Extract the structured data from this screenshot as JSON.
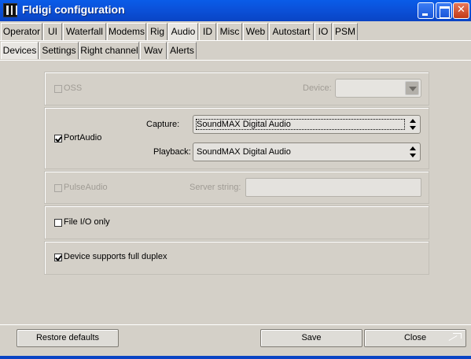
{
  "window": {
    "title": "Fldigi configuration"
  },
  "main_tabs": [
    {
      "label": "Operator",
      "active": false
    },
    {
      "label": "UI",
      "active": false
    },
    {
      "label": "Waterfall",
      "active": false
    },
    {
      "label": "Modems",
      "active": false
    },
    {
      "label": "Rig",
      "active": false
    },
    {
      "label": "Audio",
      "active": true
    },
    {
      "label": "ID",
      "active": false
    },
    {
      "label": "Misc",
      "active": false
    },
    {
      "label": "Web",
      "active": false
    },
    {
      "label": "Autostart",
      "active": false
    },
    {
      "label": "IO",
      "active": false
    },
    {
      "label": "PSM",
      "active": false
    }
  ],
  "sub_tabs": [
    {
      "label": "Devices",
      "active": true
    },
    {
      "label": "Settings",
      "active": false
    },
    {
      "label": "Right channel",
      "active": false
    },
    {
      "label": "Wav",
      "active": false
    },
    {
      "label": "Alerts",
      "active": false
    }
  ],
  "devices": {
    "oss": {
      "label": "OSS",
      "checked": false,
      "enabled": false,
      "device_label": "Device:",
      "device_value": ""
    },
    "portaudio": {
      "label": "PortAudio",
      "checked": true,
      "capture_label": "Capture:",
      "capture_value": "SoundMAX Digital Audio",
      "playback_label": "Playback:",
      "playback_value": "SoundMAX Digital Audio"
    },
    "pulseaudio": {
      "label": "PulseAudio",
      "checked": false,
      "enabled": false,
      "server_label": "Server string:",
      "server_value": ""
    },
    "file_io": {
      "label": "File I/O only",
      "checked": false
    },
    "full_duplex": {
      "label": "Device supports full duplex",
      "checked": true
    }
  },
  "footer": {
    "restore_label": "Restore defaults",
    "save_label": "Save",
    "close_label": "Close"
  }
}
